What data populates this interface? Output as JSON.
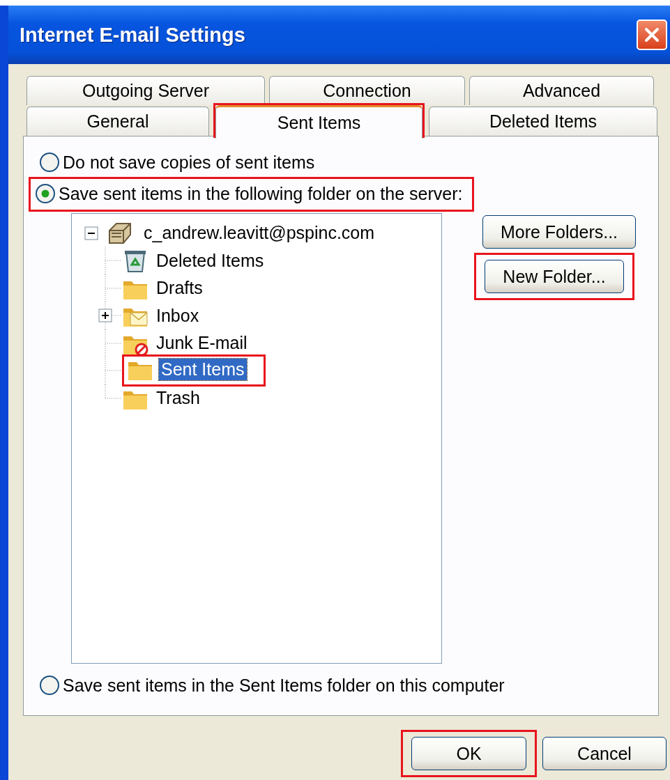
{
  "window": {
    "title": "Internet E-mail Settings"
  },
  "tab_rows": [
    {
      "tabs": [
        {
          "label": "Outgoing Server",
          "selected": false,
          "highlighted": false
        },
        {
          "label": "Connection",
          "selected": false,
          "highlighted": false
        },
        {
          "label": "Advanced",
          "selected": false,
          "highlighted": false
        }
      ]
    },
    {
      "tabs": [
        {
          "label": "General",
          "selected": false,
          "highlighted": false
        },
        {
          "label": "Sent Items",
          "selected": true,
          "highlighted": true
        },
        {
          "label": "Deleted Items",
          "selected": false,
          "highlighted": false
        }
      ]
    }
  ],
  "save_options": [
    {
      "label": "Do not save copies of sent items",
      "selected": false,
      "highlighted": false
    },
    {
      "label": "Save sent items in the following folder on the server:",
      "selected": true,
      "highlighted": true
    },
    {
      "label": "Save sent items in the Sent Items folder on this computer",
      "selected": false,
      "highlighted": false
    }
  ],
  "folder_tree": {
    "root": {
      "label": "c_andrew.leavitt@pspinc.com",
      "expanded": true,
      "children": [
        {
          "label": "Deleted Items",
          "kind": "deleted",
          "collapsed": false,
          "selected": false,
          "highlighted": false
        },
        {
          "label": "Drafts",
          "kind": "folder",
          "collapsed": false,
          "selected": false,
          "highlighted": false
        },
        {
          "label": "Inbox",
          "kind": "inbox",
          "collapsed": true,
          "selected": false,
          "highlighted": false
        },
        {
          "label": "Junk E-mail",
          "kind": "junk",
          "collapsed": false,
          "selected": false,
          "highlighted": false
        },
        {
          "label": "Sent Items",
          "kind": "folder",
          "collapsed": false,
          "selected": true,
          "highlighted": true
        },
        {
          "label": "Trash",
          "kind": "folder",
          "collapsed": false,
          "selected": false,
          "highlighted": false
        }
      ]
    }
  },
  "side_buttons": [
    {
      "label": "More Folders...",
      "highlighted": false
    },
    {
      "label": "New Folder...",
      "highlighted": true
    }
  ],
  "dialog_buttons": [
    {
      "label": "OK",
      "highlighted": true
    },
    {
      "label": "Cancel",
      "highlighted": false
    }
  ]
}
